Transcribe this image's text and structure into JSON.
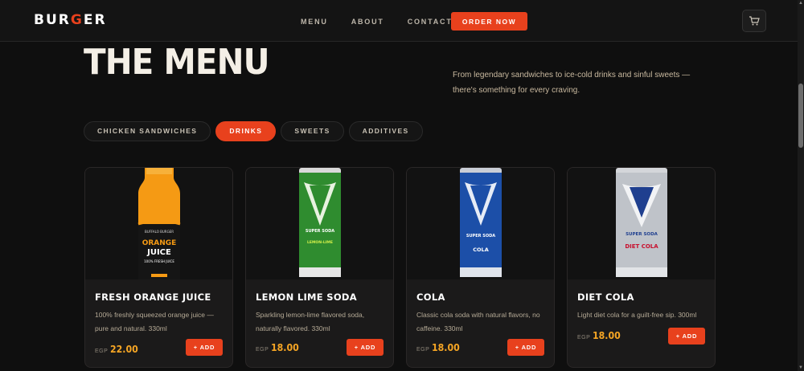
{
  "nav": {
    "logo": {
      "part1": "BUR",
      "part2": "G",
      "part3": "ER"
    },
    "links": [
      "MENU",
      "ABOUT",
      "CONTACT"
    ],
    "order_label": "ORDER NOW",
    "cart_icon": "cart-icon"
  },
  "hero": {
    "title": "THE MENU",
    "subtitle": "From legendary sandwiches to ice-cold drinks and sinful sweets — there's something for every craving."
  },
  "tabs": [
    {
      "label": "CHICKEN SANDWICHES",
      "active": false
    },
    {
      "label": "DRINKS",
      "active": true
    },
    {
      "label": "SWEETS",
      "active": false
    },
    {
      "label": "ADDITIVES",
      "active": false
    }
  ],
  "items": [
    {
      "name": "FRESH ORANGE JUICE",
      "desc": "100% freshly squeezed orange juice — pure and natural. 330ml",
      "currency": "EGP",
      "price": "22.00",
      "add_label": "+ ADD",
      "product_text": {
        "brand": "BUFFALO BURGER",
        "line1": "ORANGE",
        "line2": "JUICE",
        "line3": "100% FRESH JUICE"
      }
    },
    {
      "name": "LEMON LIME SODA",
      "desc": "Sparkling lemon-lime flavored soda, naturally flavored. 330ml",
      "currency": "EGP",
      "price": "18.00",
      "add_label": "+ ADD",
      "product_text": {
        "brand": "SUPER SODA",
        "flavor": "LEMON-LIME"
      }
    },
    {
      "name": "COLA",
      "desc": "Classic cola soda with natural flavors, no caffeine. 330ml",
      "currency": "EGP",
      "price": "18.00",
      "add_label": "+ ADD",
      "product_text": {
        "brand": "SUPER SODA",
        "flavor": "COLA"
      }
    },
    {
      "name": "DIET COLA",
      "desc": "Light diet cola for a guilt-free sip. 300ml",
      "currency": "EGP",
      "price": "18.00",
      "add_label": "+ ADD",
      "product_text": {
        "brand": "SUPER SODA",
        "flavor": "DIET COLA"
      }
    }
  ],
  "colors": {
    "accent": "#e8411d",
    "price": "#f5a524",
    "background": "#0f0f0f"
  }
}
